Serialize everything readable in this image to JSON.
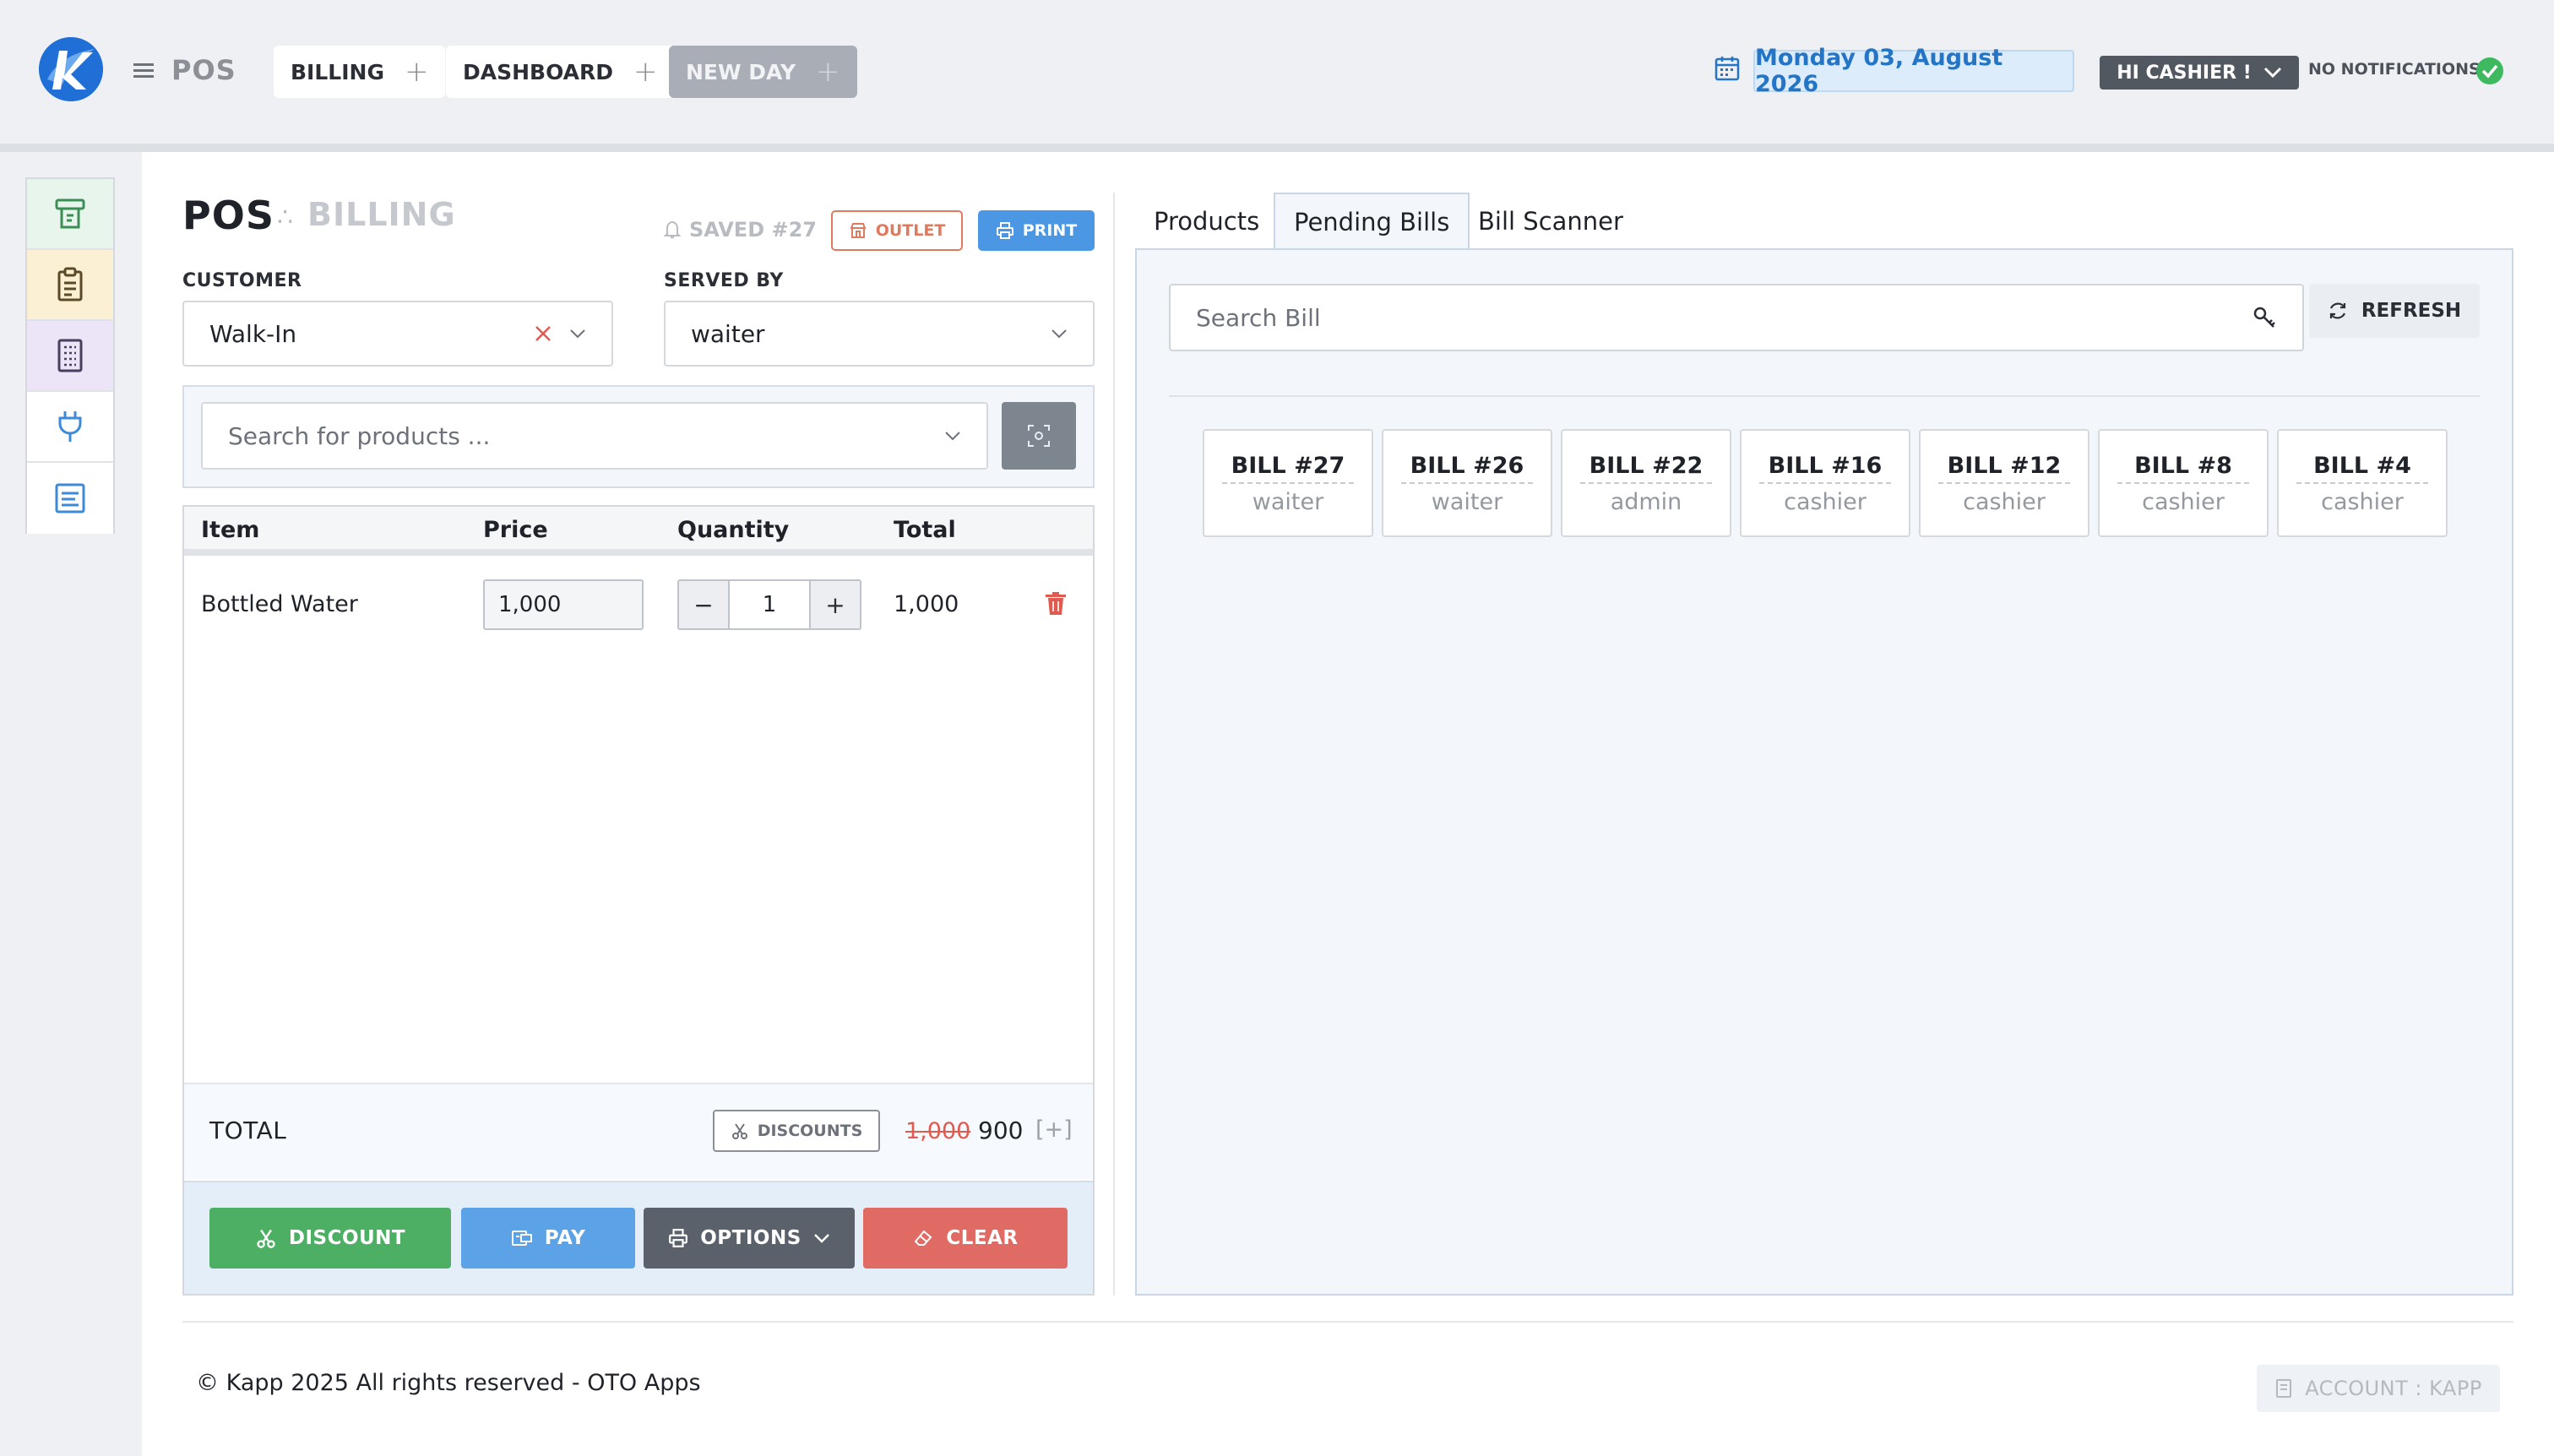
{
  "header": {
    "app_name": "POS",
    "tabs": [
      {
        "label": "BILLING",
        "plus": "+"
      },
      {
        "label": "DASHBOARD",
        "plus": "+"
      },
      {
        "label": "NEW DAY",
        "plus": "+"
      }
    ],
    "date": "Monday 03, August 2026",
    "user_label": "HI CASHIER !",
    "notifications": "NO NOTIFICATIONS",
    "colors": {
      "accent": "#2475c6",
      "success": "#3fb95f"
    }
  },
  "sidebar": {
    "items": [
      {
        "icon": "cash-register-icon",
        "bg": "#e8f5ec",
        "color": "#3b8f55"
      },
      {
        "icon": "clipboard-icon",
        "bg": "#fbf0d3",
        "color": "#5a4a28"
      },
      {
        "icon": "receipt-icon",
        "bg": "#ece4f7",
        "color": "#4a3f5e"
      },
      {
        "icon": "plug-icon",
        "bg": "#ffffff",
        "color": "#3c8ad8"
      },
      {
        "icon": "document-icon",
        "bg": "#ffffff",
        "color": "#3c8ad8"
      }
    ]
  },
  "billing": {
    "title": "POS",
    "separator": "∴",
    "subtitle": "BILLING",
    "saved": "SAVED #27",
    "outlet_label": "OUTLET",
    "print_label": "PRINT",
    "customer_label": "CUSTOMER",
    "customer_value": "Walk-In",
    "served_label": "SERVED BY",
    "served_value": "waiter",
    "product_search_placeholder": "Search for products ...",
    "columns": [
      "Item",
      "Price",
      "Quantity",
      "Total"
    ],
    "rows": [
      {
        "item": "Bottled Water",
        "price": "1,000",
        "qty": "1",
        "total": "1,000"
      }
    ],
    "total_label": "TOTAL",
    "discounts_label": "DISCOUNTS",
    "old_total": "1,000",
    "new_total": "900",
    "plus_marker": "[+]",
    "actions": {
      "discount": "DISCOUNT",
      "pay": "PAY",
      "options": "OPTIONS",
      "clear": "CLEAR"
    }
  },
  "right": {
    "tabs": [
      "Products",
      "Pending Bills",
      "Bill Scanner"
    ],
    "active_tab": "Pending Bills",
    "search_placeholder": "Search Bill",
    "refresh_label": "REFRESH",
    "bills": [
      {
        "no": "BILL #27",
        "who": "waiter"
      },
      {
        "no": "BILL #26",
        "who": "waiter"
      },
      {
        "no": "BILL #22",
        "who": "admin"
      },
      {
        "no": "BILL #16",
        "who": "cashier"
      },
      {
        "no": "BILL #12",
        "who": "cashier"
      },
      {
        "no": "BILL #8",
        "who": "cashier"
      },
      {
        "no": "BILL #4",
        "who": "cashier"
      }
    ]
  },
  "footer": {
    "copyright": "© Kapp 2025 All rights reserved - OTO Apps",
    "account": "ACCOUNT : KAPP"
  }
}
